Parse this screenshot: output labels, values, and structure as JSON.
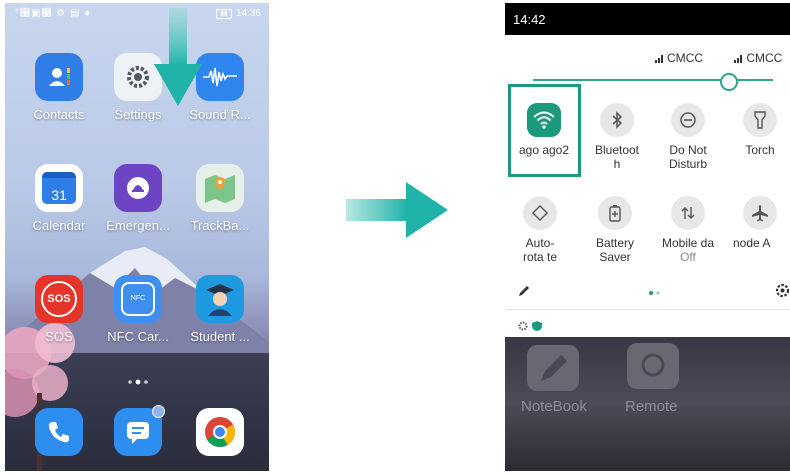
{
  "left_phone": {
    "status": {
      "time": "14:36",
      "left_icons": "°⹩▣⹩ ⚙ ▤ ●"
    },
    "apps": [
      {
        "label": "Contacts",
        "icon": "contacts-icon",
        "color": "#2f7ee8"
      },
      {
        "label": "Settings",
        "icon": "settings-icon",
        "color": "#eef1f5"
      },
      {
        "label": "Sound R...",
        "icon": "sound-recorder-icon",
        "color": "#2f86ee"
      },
      {
        "label": "Calendar",
        "icon": "calendar-icon",
        "color": "#ffffff",
        "day": "31"
      },
      {
        "label": "Emergen...",
        "icon": "emergency-icon",
        "color": "#6d44c4"
      },
      {
        "label": "TrackBa...",
        "icon": "trackback-map-icon",
        "color": "#e6efe8"
      },
      {
        "label": "SOS",
        "icon": "sos-icon",
        "color": "#e5352a",
        "badge_text": "SOS"
      },
      {
        "label": "NFC Car...",
        "icon": "nfc-card-icon",
        "color": "#3f8ff0",
        "badge_text": "NFC"
      },
      {
        "label": "Student ...",
        "icon": "student-icon",
        "color": "#1e9ae0"
      }
    ],
    "dock": [
      {
        "icon": "phone-icon",
        "color": "#2e8ef0"
      },
      {
        "icon": "messages-icon",
        "color": "#2e8ef0"
      },
      {
        "icon": "chrome-icon",
        "color": "#ffffff"
      }
    ]
  },
  "right_phone": {
    "status": {
      "time": "14:42"
    },
    "carriers": [
      "CMCC",
      "CMCC"
    ],
    "brightness_level": 0.83,
    "tiles_row1": [
      {
        "title": "ago ago2",
        "sub": "",
        "icon": "wifi-icon",
        "active": true
      },
      {
        "title": "Bluetoot h",
        "sub": "",
        "icon": "bluetooth-icon"
      },
      {
        "title": "Do Not Disturb",
        "sub": "",
        "icon": "do-not-disturb-icon"
      },
      {
        "title": "Torch",
        "sub": "",
        "icon": "torch-icon"
      }
    ],
    "tiles_row2": [
      {
        "title": "Auto-rota te",
        "sub": "",
        "icon": "auto-rotate-icon"
      },
      {
        "title": "Battery Saver",
        "sub": "",
        "icon": "battery-saver-icon"
      },
      {
        "title": "Mobile da",
        "sub": "Off",
        "icon": "mobile-data-icon"
      },
      {
        "title": "node  A",
        "sub": "",
        "icon": "airplane-icon"
      }
    ],
    "bg_apps": [
      "NoteBook",
      "Remote"
    ]
  }
}
